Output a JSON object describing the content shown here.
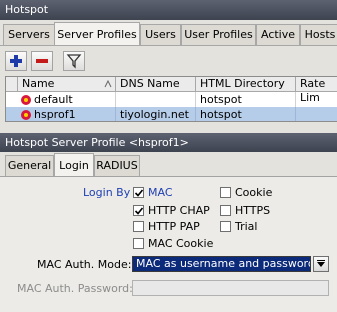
{
  "window": {
    "title": "Hotspot"
  },
  "main_tabs": [
    {
      "label": "Servers"
    },
    {
      "label": "Server Profiles"
    },
    {
      "label": "Users"
    },
    {
      "label": "User Profiles"
    },
    {
      "label": "Active"
    },
    {
      "label": "Hosts"
    }
  ],
  "toolbar": {
    "add_icon": "plus-icon",
    "remove_icon": "minus-icon",
    "filter_icon": "filter-icon"
  },
  "table": {
    "columns": [
      "Name",
      "DNS Name",
      "HTML Directory",
      "Rate Lim"
    ],
    "rows": [
      {
        "name": "default",
        "dns": "",
        "html_dir": "hotspot",
        "selected": false
      },
      {
        "name": "hsprof1",
        "dns": "tiyologin.net",
        "html_dir": "hotspot",
        "selected": true
      }
    ]
  },
  "dialog": {
    "title": "Hotspot Server Profile <hsprof1>",
    "tabs": [
      {
        "label": "General"
      },
      {
        "label": "Login"
      },
      {
        "label": "RADIUS"
      }
    ],
    "login_by_label": "Login By",
    "options": {
      "mac": {
        "label": "MAC",
        "checked": true
      },
      "http_chap": {
        "label": "HTTP CHAP",
        "checked": true
      },
      "http_pap": {
        "label": "HTTP PAP",
        "checked": false
      },
      "mac_cookie": {
        "label": "MAC Cookie",
        "checked": false
      },
      "cookie": {
        "label": "Cookie",
        "checked": false
      },
      "https": {
        "label": "HTTPS",
        "checked": false
      },
      "trial": {
        "label": "Trial",
        "checked": false
      }
    },
    "mac_auth_mode_label": "MAC Auth. Mode:",
    "mac_auth_mode_value": "MAC as username and password",
    "mac_auth_password_label": "MAC Auth. Password:",
    "mac_auth_password_value": ""
  },
  "colors": {
    "titlebar": "#4a4f5d",
    "selection": "#b6cdea",
    "select_bg": "#0c2a7a",
    "accent_blue": "#1f3fb4"
  }
}
